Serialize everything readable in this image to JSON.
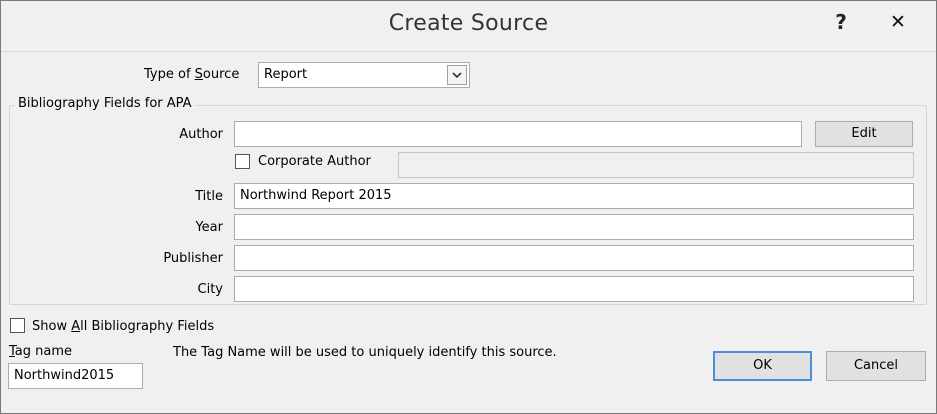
{
  "window": {
    "title": "Create Source",
    "help_label": "?",
    "close_label": "✕"
  },
  "type_of_source": {
    "label_pre": "Type of ",
    "label_accel": "S",
    "label_post": "ource",
    "value": "Report"
  },
  "group": {
    "label": "Bibliography Fields for APA"
  },
  "fields": {
    "author": {
      "label": "Author",
      "value": ""
    },
    "edit_button": "Edit",
    "corporate_author": {
      "label": "Corporate Author",
      "checked": false,
      "value": ""
    },
    "title": {
      "label": "Title",
      "value": "Northwind Report 2015"
    },
    "year": {
      "label": "Year",
      "value": ""
    },
    "publisher": {
      "label": "Publisher",
      "value": ""
    },
    "city": {
      "label": "City",
      "value": ""
    }
  },
  "show_all": {
    "label_pre": "Show ",
    "label_accel": "A",
    "label_post": "ll Bibliography Fields",
    "checked": false
  },
  "tag": {
    "label_accel": "T",
    "label_post": "ag name",
    "value": "Northwind2015",
    "hint": "The Tag Name will be used to uniquely identify this source."
  },
  "buttons": {
    "ok": "OK",
    "cancel": "Cancel"
  },
  "colors": {
    "background": "#f0f0f0",
    "default_button_border": "#4a90d9"
  }
}
